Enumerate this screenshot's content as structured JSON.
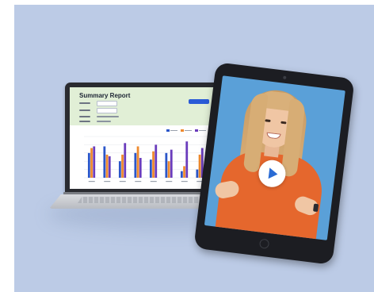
{
  "report": {
    "title": "Summary Report"
  },
  "chart_data": {
    "type": "bar",
    "categories": [
      "",
      "",
      "",
      "",
      "",
      "",
      "",
      ""
    ],
    "series": [
      {
        "values": [
          30,
          38,
          20,
          30,
          22,
          30,
          8,
          10
        ]
      },
      {
        "values": [
          36,
          28,
          28,
          38,
          32,
          20,
          14,
          28
        ]
      },
      {
        "values": [
          38,
          26,
          42,
          24,
          40,
          34,
          44,
          36
        ]
      }
    ],
    "colors": [
      "#2b56c9",
      "#ef8a2e",
      "#6a3cbc"
    ],
    "ylim": [
      0,
      50
    ],
    "grid": true,
    "legend": "top-right"
  },
  "video": {
    "accent_color": "#2a6bd4",
    "play_icon": "play-icon"
  },
  "colors": {
    "background": "#bccbe6",
    "report_header": "#e1efd6",
    "presenter_top": "#e5672d"
  }
}
